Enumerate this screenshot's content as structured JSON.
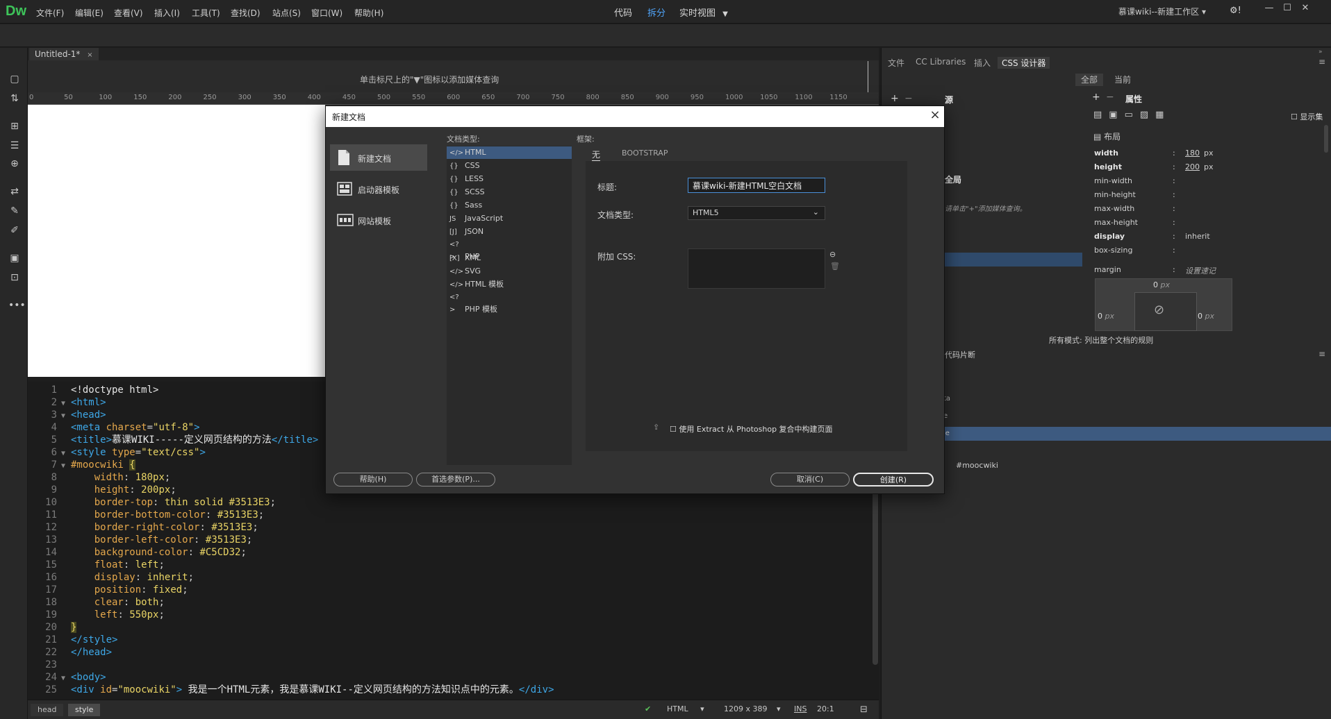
{
  "app": {
    "logo": "Dw",
    "menu": [
      "文件(F)",
      "编辑(E)",
      "查看(V)",
      "插入(I)",
      "工具(T)",
      "查找(D)",
      "站点(S)",
      "窗口(W)",
      "帮助(H)"
    ],
    "workspace": "慕课wiki--新建工作区",
    "window_buttons": [
      "—",
      "☐",
      "✕"
    ]
  },
  "viewbar": {
    "code": "代码",
    "split": "拆分",
    "live": "实时视图"
  },
  "document": {
    "tab": "Untitled-1*",
    "mq_hint": "单击标尺上的\"▼\"图标以添加媒体查询",
    "ruler": [
      "0",
      "50",
      "100",
      "150",
      "200",
      "250",
      "300",
      "350",
      "400",
      "450",
      "500",
      "550",
      "600",
      "650",
      "700",
      "750",
      "800",
      "850",
      "900",
      "950",
      "1000",
      "1050",
      "1100",
      "1150"
    ]
  },
  "code_lines": [
    {
      "n": "1",
      "fold": "",
      "html": "<span class=\"txt\">&lt;!doctype html&gt;</span>"
    },
    {
      "n": "2",
      "fold": "▼",
      "html": "<span class=\"tag\">&lt;html&gt;</span>"
    },
    {
      "n": "3",
      "fold": "▼",
      "html": "<span class=\"tag\">&lt;head&gt;</span>"
    },
    {
      "n": "4",
      "fold": "",
      "html": "<span class=\"tag\">&lt;meta</span> <span class=\"attr\">charset</span><span class=\"punc\">=</span><span class=\"str\">\"utf-8\"</span><span class=\"tag\">&gt;</span>"
    },
    {
      "n": "5",
      "fold": "",
      "html": "<span class=\"tag\">&lt;title&gt;</span><span class=\"txt\">慕课WIKI-----定义网页结构的方法</span><span class=\"tag\">&lt;/title&gt;</span>"
    },
    {
      "n": "6",
      "fold": "▼",
      "html": "<span class=\"tag\">&lt;style</span> <span class=\"attr\">type</span><span class=\"punc\">=</span><span class=\"str\">\"text/css\"</span><span class=\"tag\">&gt;</span>"
    },
    {
      "n": "7",
      "fold": "▼",
      "html": "<span class=\"sel\">#moocwiki</span> <span class=\"str\" style=\"background:#4a4a20\">{</span>"
    },
    {
      "n": "8",
      "fold": "",
      "html": "    <span class=\"prop\">width</span><span class=\"punc\">:</span> <span class=\"val\">180px</span><span class=\"punc\">;</span>"
    },
    {
      "n": "9",
      "fold": "",
      "html": "    <span class=\"prop\">height</span><span class=\"punc\">:</span> <span class=\"val\">200px</span><span class=\"punc\">;</span>"
    },
    {
      "n": "10",
      "fold": "",
      "html": "    <span class=\"prop\">border-top</span><span class=\"punc\">:</span> <span class=\"val\">thin solid #3513E3</span><span class=\"punc\">;</span>"
    },
    {
      "n": "11",
      "fold": "",
      "html": "    <span class=\"prop\">border-bottom-color</span><span class=\"punc\">:</span> <span class=\"val\">#3513E3</span><span class=\"punc\">;</span>"
    },
    {
      "n": "12",
      "fold": "",
      "html": "    <span class=\"prop\">border-right-color</span><span class=\"punc\">:</span> <span class=\"val\">#3513E3</span><span class=\"punc\">;</span>"
    },
    {
      "n": "13",
      "fold": "",
      "html": "    <span class=\"prop\">border-left-color</span><span class=\"punc\">:</span> <span class=\"val\">#3513E3</span><span class=\"punc\">;</span>"
    },
    {
      "n": "14",
      "fold": "",
      "html": "    <span class=\"prop\">background-color</span><span class=\"punc\">:</span> <span class=\"val\">#C5CD32</span><span class=\"punc\">;</span>"
    },
    {
      "n": "15",
      "fold": "",
      "html": "    <span class=\"prop\">float</span><span class=\"punc\">:</span> <span class=\"val\">left</span><span class=\"punc\">;</span>"
    },
    {
      "n": "16",
      "fold": "",
      "html": "    <span class=\"prop\">display</span><span class=\"punc\">:</span> <span class=\"val\">inherit</span><span class=\"punc\">;</span>"
    },
    {
      "n": "17",
      "fold": "",
      "html": "    <span class=\"prop\">position</span><span class=\"punc\">:</span> <span class=\"val\">fixed</span><span class=\"punc\">;</span>"
    },
    {
      "n": "18",
      "fold": "",
      "html": "    <span class=\"prop\">clear</span><span class=\"punc\">:</span> <span class=\"val\">both</span><span class=\"punc\">;</span>"
    },
    {
      "n": "19",
      "fold": "",
      "html": "    <span class=\"prop\">left</span><span class=\"punc\">:</span> <span class=\"val\">550px</span><span class=\"punc\">;</span>"
    },
    {
      "n": "20",
      "fold": "",
      "html": "<span class=\"str\" style=\"background:#4a4a20\">}</span>"
    },
    {
      "n": "21",
      "fold": "",
      "html": "<span class=\"tag\">&lt;/style&gt;</span>"
    },
    {
      "n": "22",
      "fold": "",
      "html": "<span class=\"tag\">&lt;/head&gt;</span>"
    },
    {
      "n": "23",
      "fold": "",
      "html": ""
    },
    {
      "n": "24",
      "fold": "▼",
      "html": "<span class=\"tag\">&lt;body&gt;</span>"
    },
    {
      "n": "25",
      "fold": "",
      "html": "<span class=\"tag\">&lt;div</span> <span class=\"attr\">id</span><span class=\"punc\">=</span><span class=\"str\">\"moocwiki\"</span><span class=\"tag\">&gt;</span> <span class=\"txt\">我是一个HTML元素，我是慕课WIKI--定义网页结构的方法知识点中的元素。</span><span class=\"tag\">&lt;/div&gt;</span>"
    }
  ],
  "statusbar": {
    "crumbs": [
      "head",
      "style"
    ],
    "lang": "HTML",
    "size": "1209 x 389",
    "mode": "INS",
    "pos": "20:1"
  },
  "rightpanel": {
    "tabs": [
      "文件",
      "CC Libraries",
      "插入",
      "CSS 设计器"
    ],
    "subtabs": [
      "全部",
      "当前"
    ],
    "props_header": "属性",
    "show_set": "显示集",
    "layout": "布局",
    "props": [
      {
        "name": "width",
        "val": "180",
        "unit": "px",
        "bold": true
      },
      {
        "name": "height",
        "val": "200",
        "unit": "px",
        "bold": true
      },
      {
        "name": "min-width",
        "val": "",
        "unit": "",
        "bold": false
      },
      {
        "name": "min-height",
        "val": "",
        "unit": "",
        "bold": false
      },
      {
        "name": "max-width",
        "val": "",
        "unit": "",
        "bold": false
      },
      {
        "name": "max-height",
        "val": "",
        "unit": "",
        "bold": false
      },
      {
        "name": "display",
        "val": "inherit",
        "unit": "",
        "bold": true
      },
      {
        "name": "box-sizing",
        "val": "",
        "unit": "",
        "bold": false
      }
    ],
    "margin_label": "margin",
    "margin_hint": "设置速记",
    "box_top": "0",
    "box_left": "0",
    "box_right": "0",
    "box_unit": "px",
    "all_mode": "所有模式: 列出整个文档的规则",
    "selectors_label": "全局",
    "media_hint": "请单击\"+\"添加媒体查询。",
    "snippets": "代码片断",
    "snippet_item": "#moocwiki",
    "source_partial": "源",
    "selector_partials": [
      "ta",
      "e",
      "le"
    ]
  },
  "dialog": {
    "title": "新建文档",
    "categories": [
      "新建文档",
      "启动器模板",
      "网站模板"
    ],
    "doctype_header": "文档类型:",
    "frame_header": "框架:",
    "doc_types": [
      {
        "icon": "</>",
        "label": "HTML"
      },
      {
        "icon": "{}",
        "label": "CSS"
      },
      {
        "icon": "{}",
        "label": "LESS"
      },
      {
        "icon": "{}",
        "label": "SCSS"
      },
      {
        "icon": "{}",
        "label": "Sass"
      },
      {
        "icon": "JS",
        "label": "JavaScript"
      },
      {
        "icon": "[J]",
        "label": "JSON"
      },
      {
        "icon": "<?>",
        "label": "PHP"
      },
      {
        "icon": "[X]",
        "label": "XML"
      },
      {
        "icon": "</>",
        "label": "SVG"
      },
      {
        "icon": "</>",
        "label": "HTML 模板"
      },
      {
        "icon": "<?>",
        "label": "PHP 模板"
      }
    ],
    "frame_tabs": [
      "无",
      "BOOTSTRAP"
    ],
    "title_label": "标题:",
    "title_value": "慕课wiki-新建HTML空白文档",
    "doctype_label": "文档类型:",
    "doctype_value": "HTML5",
    "css_label": "附加 CSS:",
    "extract_label": "使用 Extract 从 Photoshop 复合中构建页面",
    "buttons": {
      "help": "帮助(H)",
      "prefs": "首选参数(P)...",
      "cancel": "取消(C)",
      "create": "创建(R)"
    }
  }
}
